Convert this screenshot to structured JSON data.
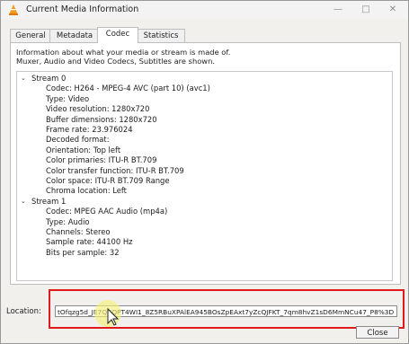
{
  "window": {
    "title": "Current Media Information",
    "minimize_glyph": "—",
    "maximize_glyph": "□",
    "close_glyph": "✕"
  },
  "tabs": [
    {
      "label": "General",
      "active": false
    },
    {
      "label": "Metadata",
      "active": false
    },
    {
      "label": "Codec",
      "active": true
    },
    {
      "label": "Statistics",
      "active": false
    }
  ],
  "info_lines": [
    "Information about what your media or stream is made of.",
    "Muxer, Audio and Video Codecs, Subtitles are shown."
  ],
  "streams": [
    {
      "label": "Stream 0",
      "expanded_glyph": "⌄",
      "properties": [
        "Codec: H264 - MPEG-4 AVC (part 10) (avc1)",
        "Type: Video",
        "Video resolution: 1280x720",
        "Buffer dimensions: 1280x720",
        "Frame rate: 23.976024",
        "Decoded format:",
        "Orientation: Top left",
        "Color primaries: ITU-R BT.709",
        "Color transfer function: ITU-R BT.709",
        "Color space: ITU-R BT.709 Range",
        "Chroma location: Left"
      ]
    },
    {
      "label": "Stream 1",
      "expanded_glyph": "⌄",
      "properties": [
        "Codec: MPEG AAC Audio (mp4a)",
        "Type: Audio",
        "Channels: Stereo",
        "Sample rate: 44100 Hz",
        "Bits per sample: 32"
      ]
    }
  ],
  "location": {
    "label": "Location:",
    "value": "tOfqzg5d_JE7QCQPT4WI1_8Z5RBuXPAlEA945BOsZpEAxt7yZcQJFKT_7qm8hvZ1sD6MmNCu47_P8%3D"
  },
  "close_label": "Close",
  "colors": {
    "highlight": "#e01a1a",
    "app_icon": "#f29b1d"
  }
}
